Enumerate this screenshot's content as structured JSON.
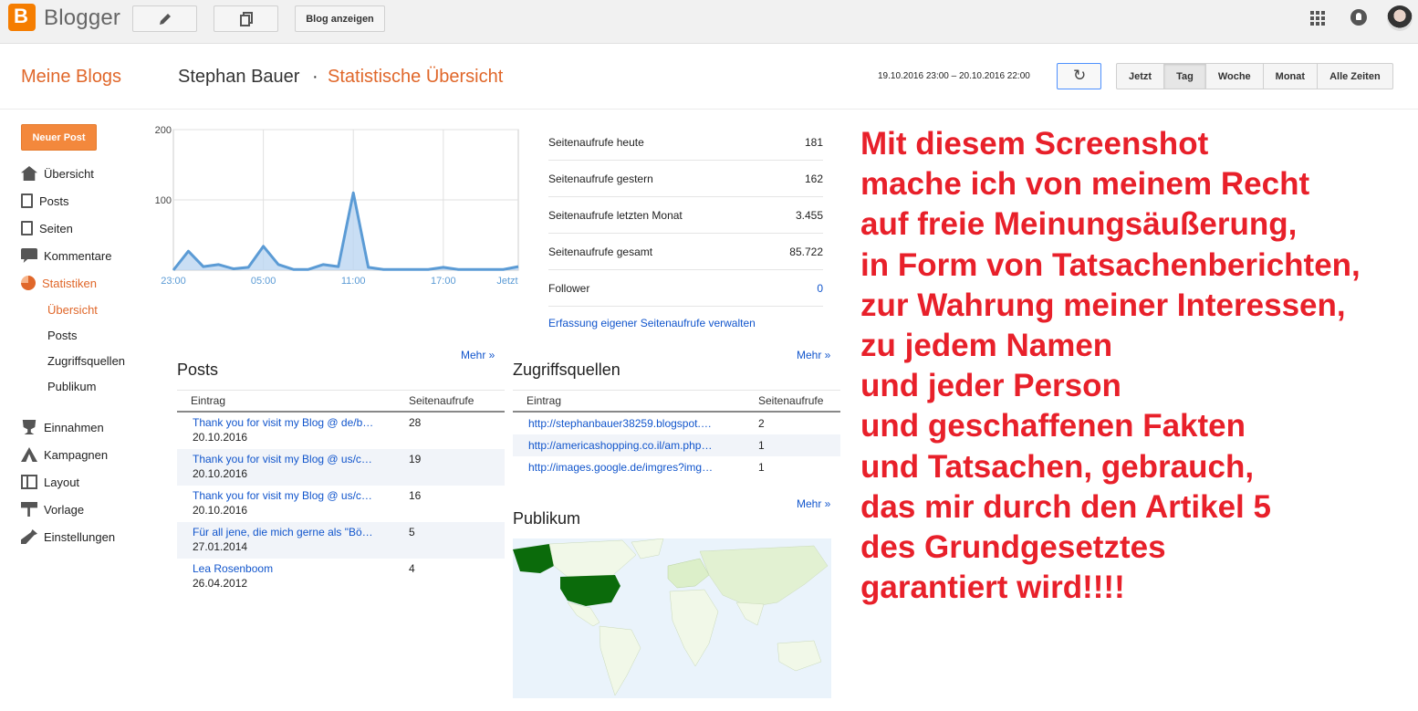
{
  "topbar": {
    "logo_letter": "B",
    "logo_text": "Blogger",
    "view_blog_label": "Blog anzeigen",
    "icons": [
      "pencil-icon",
      "pages-icon",
      "apps-grid-icon",
      "notifications-icon",
      "avatar"
    ]
  },
  "header": {
    "my_blogs": "Meine Blogs",
    "blog_name": "Stephan Bauer",
    "separator": "·",
    "section": "Statistische Übersicht",
    "date_range": "19.10.2016 23:00 – 20.10.2016 22:00",
    "refresh_icon": "↻",
    "periods": [
      {
        "label": "Jetzt",
        "active": false
      },
      {
        "label": "Tag",
        "active": true
      },
      {
        "label": "Woche",
        "active": false
      },
      {
        "label": "Monat",
        "active": false
      },
      {
        "label": "Alle Zeiten",
        "active": false
      }
    ]
  },
  "sidebar": {
    "new_post": "Neuer Post",
    "items": [
      {
        "label": "Übersicht",
        "icon": "home-icon",
        "active": false
      },
      {
        "label": "Posts",
        "icon": "posts-icon",
        "active": false
      },
      {
        "label": "Seiten",
        "icon": "pages-icon",
        "active": false
      },
      {
        "label": "Kommentare",
        "icon": "comments-icon",
        "active": false
      },
      {
        "label": "Statistiken",
        "icon": "stats-icon",
        "active": true
      }
    ],
    "stats_sub": [
      {
        "label": "Übersicht",
        "active": true
      },
      {
        "label": "Posts",
        "active": false
      },
      {
        "label": "Zugriffsquellen",
        "active": false
      },
      {
        "label": "Publikum",
        "active": false
      }
    ],
    "items2": [
      {
        "label": "Einnahmen",
        "icon": "trophy-icon"
      },
      {
        "label": "Kampagnen",
        "icon": "campaign-icon"
      },
      {
        "label": "Layout",
        "icon": "layout-icon"
      },
      {
        "label": "Vorlage",
        "icon": "template-icon"
      },
      {
        "label": "Einstellungen",
        "icon": "wrench-icon"
      }
    ]
  },
  "chart_data": {
    "type": "area",
    "x_ticks": [
      "23:00",
      "05:00",
      "11:00",
      "17:00",
      "Jetzt"
    ],
    "y_ticks": [
      100,
      200
    ],
    "ylim": [
      0,
      200
    ],
    "x": [
      "23:00",
      "00:00",
      "01:00",
      "02:00",
      "03:00",
      "04:00",
      "05:00",
      "06:00",
      "07:00",
      "08:00",
      "09:00",
      "10:00",
      "11:00",
      "12:00",
      "13:00",
      "14:00",
      "15:00",
      "16:00",
      "17:00",
      "18:00",
      "19:00",
      "20:00",
      "21:00",
      "22:00"
    ],
    "values": [
      0,
      27,
      5,
      8,
      2,
      4,
      34,
      8,
      1,
      1,
      8,
      5,
      110,
      4,
      1,
      1,
      1,
      1,
      4,
      1,
      1,
      1,
      1,
      5
    ],
    "grid": true,
    "color": "#5b9bd5"
  },
  "stats": {
    "rows": [
      {
        "label": "Seitenaufrufe heute",
        "value": "181",
        "link": false
      },
      {
        "label": "Seitenaufrufe gestern",
        "value": "162",
        "link": false
      },
      {
        "label": "Seitenaufrufe letzten Monat",
        "value": "3.455",
        "link": false
      },
      {
        "label": "Seitenaufrufe gesamt",
        "value": "85.722",
        "link": false
      },
      {
        "label": "Follower",
        "value": "0",
        "link": true
      }
    ],
    "manage_link": "Erfassung eigener Seitenaufrufe verwalten"
  },
  "posts": {
    "title": "Posts",
    "more": "Mehr »",
    "col_entry": "Eintrag",
    "col_views": "Seitenaufrufe",
    "rows": [
      {
        "title": "Thank you for visit my Blog @ de/b…",
        "date": "20.10.2016",
        "views": "28"
      },
      {
        "title": "Thank you for visit my Blog @ us/c…",
        "date": "20.10.2016",
        "views": "19"
      },
      {
        "title": "Thank you for visit my Blog @ us/c…",
        "date": "20.10.2016",
        "views": "16"
      },
      {
        "title": "Für all jene, die mich gerne als \"Bö…",
        "date": "27.01.2014",
        "views": "5"
      },
      {
        "title": "Lea Rosenboom",
        "date": "26.04.2012",
        "views": "4"
      }
    ]
  },
  "sources": {
    "title": "Zugriffsquellen",
    "more": "Mehr »",
    "col_entry": "Eintrag",
    "col_views": "Seitenaufrufe",
    "rows": [
      {
        "url": "http://stephanbauer38259.blogspot.…",
        "views": "2"
      },
      {
        "url": "http://americashopping.co.il/am.php…",
        "views": "1"
      },
      {
        "url": "http://images.google.de/imgres?img…",
        "views": "1"
      }
    ]
  },
  "audience": {
    "title": "Publikum",
    "more": "Mehr »"
  },
  "annotation": "Mit diesem Screenshot\nmache ich von meinem Recht\nauf freie Meinungsäußerung,\nin Form von Tatsachenberichten,\nzur Wahrung meiner Interessen,\nzu jedem Namen\nund jeder Person\nund geschaffenen Fakten\nund Tatsachen,  gebrauch,\ndas mir durch den Artikel 5\ndes Grundgesetztes\ngarantiert wird!!!!"
}
